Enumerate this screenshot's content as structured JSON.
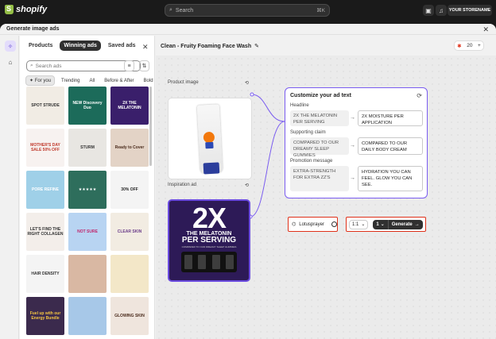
{
  "topbar": {
    "brand": "shopify",
    "search_placeholder": "Search",
    "search_shortcut": "⌘K",
    "store_name": "YOUR STORENAME"
  },
  "modal": {
    "title": "Generate image ads"
  },
  "panel": {
    "tabs": [
      "Products",
      "Winning ads",
      "Saved ads"
    ],
    "active_tab": "Winning ads",
    "search_placeholder": "Search ads",
    "filters": [
      "For you",
      "Trending",
      "All",
      "Before & After",
      "Bold"
    ],
    "thumbnails": [
      {
        "text": "SPOT STRUDE",
        "bg": "#f1ece4",
        "fg": "#333"
      },
      {
        "text": "NEW Discovery Duo",
        "bg": "#1c6b5a",
        "fg": "#fff"
      },
      {
        "text": "2X THE MELATONIN",
        "bg": "#3a1f6b",
        "fg": "#fff"
      },
      {
        "text": "MOTHER'S DAY SALE 50% OFF",
        "bg": "#f7f2f0",
        "fg": "#c0392b"
      },
      {
        "text": "STURM",
        "bg": "#e8e6e2",
        "fg": "#333"
      },
      {
        "text": "Ready to Cover",
        "bg": "#e3d3c6",
        "fg": "#4a2b1c"
      },
      {
        "text": "PORE REFINE",
        "bg": "#9fd0e8",
        "fg": "#fff"
      },
      {
        "text": "★★★★★",
        "bg": "#2e6e5c",
        "fg": "#fff"
      },
      {
        "text": "30% OFF",
        "bg": "#f4f4f4",
        "fg": "#222"
      },
      {
        "text": "LET'S FIND THE RIGHT COLLAGEN",
        "bg": "#f3eeea",
        "fg": "#333"
      },
      {
        "text": "NOT SURE",
        "bg": "#b8d4f2",
        "fg": "#c0256b"
      },
      {
        "text": "CLEAR SKIN",
        "bg": "#f2ece2",
        "fg": "#6b3d8a"
      },
      {
        "text": "HAIR DENSITY",
        "bg": "#f4f4f4",
        "fg": "#333"
      },
      {
        "text": "",
        "bg": "#d9b8a3",
        "fg": "#fff"
      },
      {
        "text": "",
        "bg": "#f3e7c8",
        "fg": "#333"
      },
      {
        "text": "Fuel up with our Energy Bundle",
        "bg": "#3b2a4d",
        "fg": "#f5c542"
      },
      {
        "text": "",
        "bg": "#a7c8e8",
        "fg": "#fff"
      },
      {
        "text": "GLOWING SKIN",
        "bg": "#efe5dd",
        "fg": "#4a2b1c"
      }
    ]
  },
  "main": {
    "product_title": "Clean - Fruity Foaming Face Wash",
    "credits": "20",
    "product_image_label": "Product image",
    "inspiration_label": "Inspiration ad",
    "inspiration": {
      "big": "2X",
      "line1": "THE MELATONIN",
      "line2": "PER SERVING",
      "line3": "COMPARED TO OUR DREAMY SLEEP GUMMIES"
    },
    "customize": {
      "title": "Customize your ad text",
      "headline_label": "Headline",
      "headline_old": "2X THE MELATONIN PER SERVING",
      "headline_new": "2X MOISTURE PER APPLICATION",
      "claim_label": "Supporting claim",
      "claim_old": "COMPARED TO OUR DREAMY SLEEP GUMMIES",
      "claim_new": "COMPARED TO OUR DAILY BODY CREAM",
      "promo_label": "Promotion message",
      "promo_old": "EXTRA-STRENGTH FOR EXTRA ZZ'S",
      "promo_new": "HYDRATION YOU CAN FEEL. GLOW YOU CAN SEE."
    },
    "brand_toggle_label": "Lotusprayer",
    "brand_toggle_on": true,
    "aspect_ratio": "1:1",
    "count": "1",
    "generate_label": "Generate"
  }
}
